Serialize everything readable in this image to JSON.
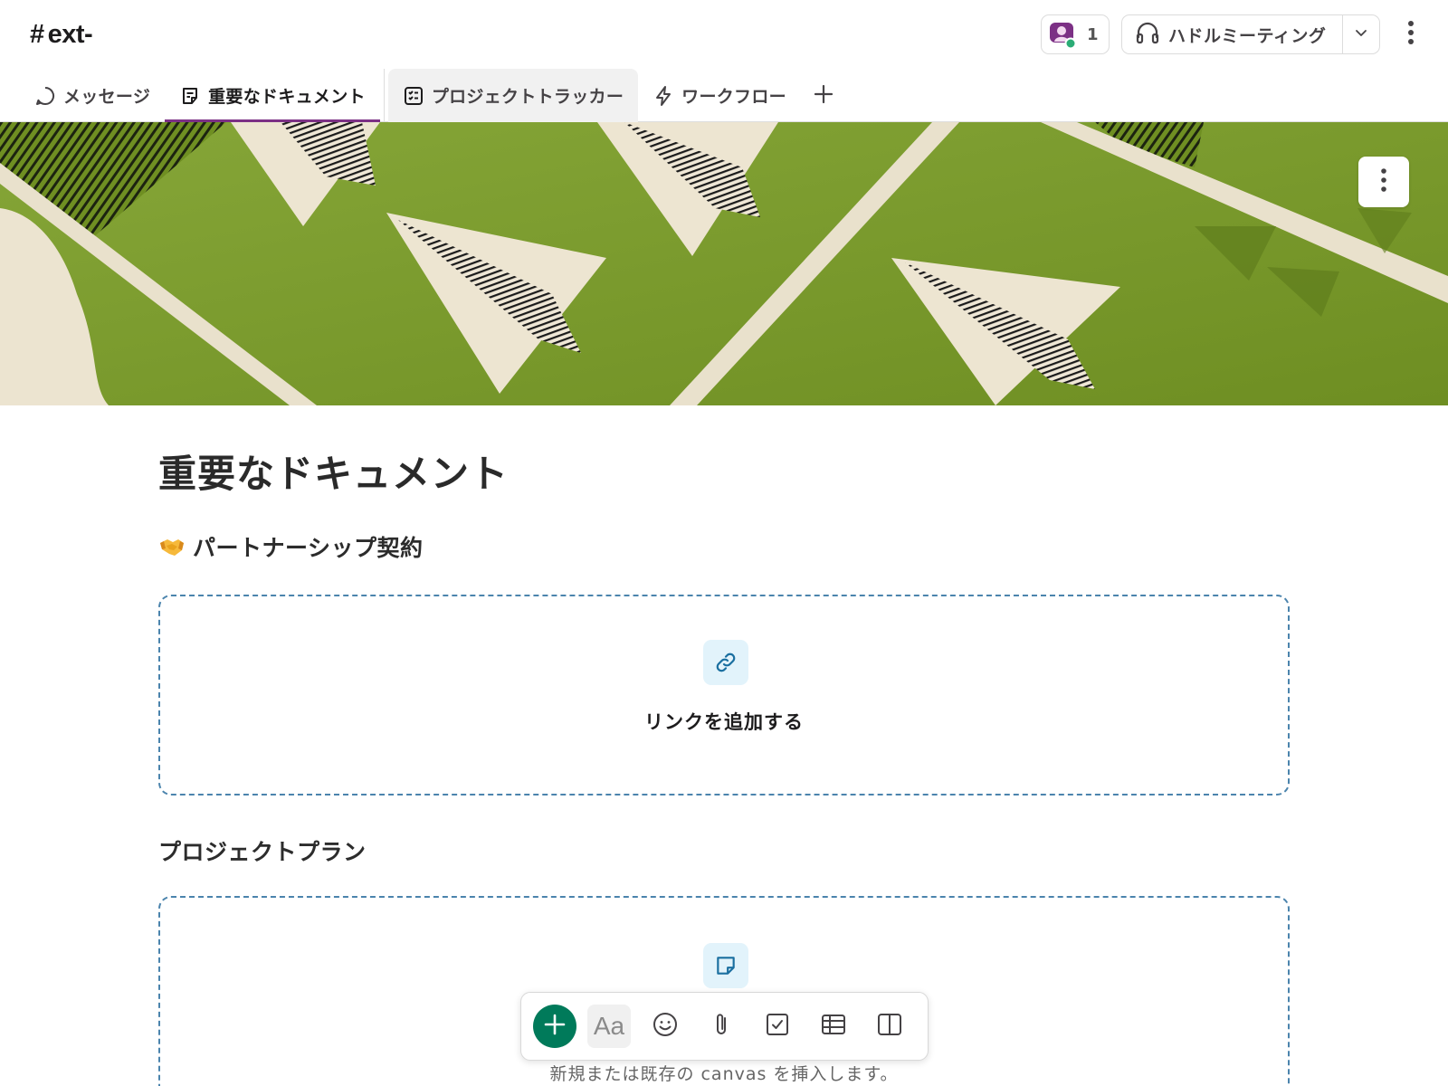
{
  "header": {
    "channel_hash": "#",
    "channel_name": "ext-",
    "member_count": "1",
    "huddle_label": "ハドルミーティング",
    "accent": "#7c3085"
  },
  "tabs": [
    {
      "label": "メッセージ",
      "icon": "message-icon"
    },
    {
      "label": "重要なドキュメント",
      "icon": "canvas-icon",
      "active": true
    },
    {
      "label": "プロジェクトトラッカー",
      "icon": "list-icon"
    },
    {
      "label": "ワークフロー",
      "icon": "lightning-icon"
    }
  ],
  "canvas": {
    "title": "重要なドキュメント",
    "sections": [
      {
        "heading": "パートナーシップ契約",
        "emoji": "handshake-emoji",
        "placeholder_label": "リンクを追加する",
        "placeholder_icon": "link-icon"
      },
      {
        "heading": "プロジェクトプラン",
        "placeholder_label": "新規または既存の canvas を挿入します。",
        "placeholder_icon": "canvas-icon"
      }
    ]
  },
  "toolbar": {
    "format_label": "Aa",
    "buttons": [
      "add-icon",
      "format-icon",
      "emoji-icon",
      "attachment-icon",
      "checklist-icon",
      "table-icon",
      "layout-icon"
    ],
    "add_color": "#007a5a"
  }
}
